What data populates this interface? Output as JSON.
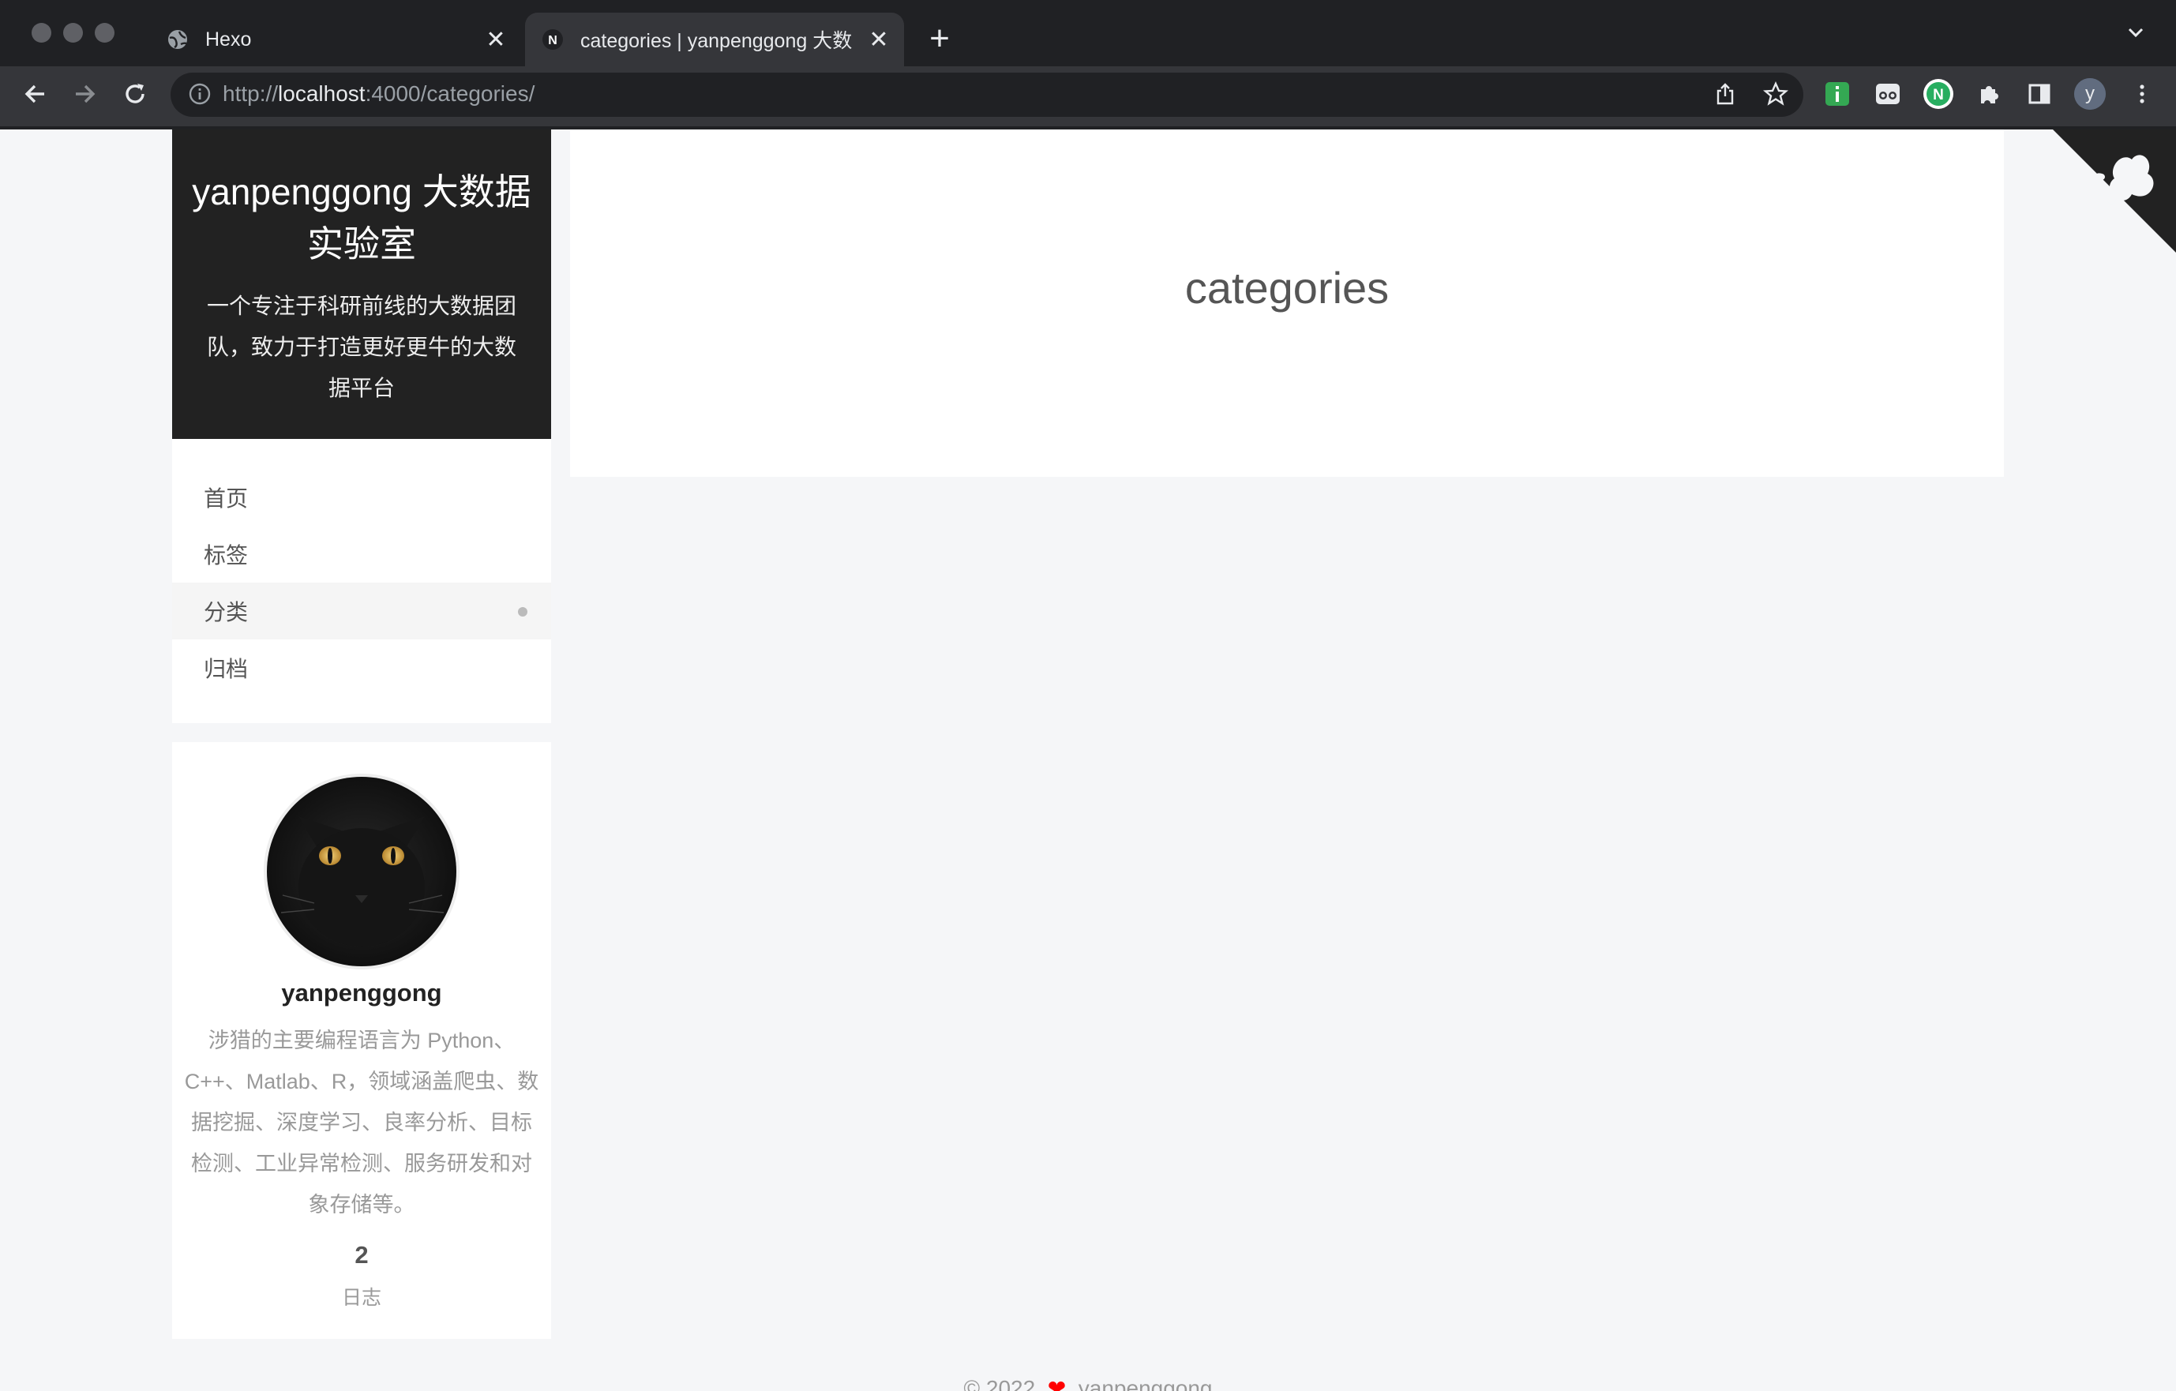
{
  "browser": {
    "tabs": [
      {
        "title": "Hexo",
        "active": false,
        "icon": "globe-icon"
      },
      {
        "title": "categories | yanpenggong 大数",
        "active": true,
        "icon": "n-favicon-icon"
      }
    ],
    "url": {
      "scheme": "http://",
      "host": "localhost",
      "rest": ":4000/categories/"
    },
    "profile_initial": "y"
  },
  "site": {
    "title": "yanpenggong 大数据实验室",
    "subtitle": "一个专注于科研前线的大数据团队，致力于打造更好更牛的大数据平台"
  },
  "menu": {
    "items": [
      {
        "label": "首页",
        "active": false
      },
      {
        "label": "标签",
        "active": false
      },
      {
        "label": "分类",
        "active": true
      },
      {
        "label": "归档",
        "active": false
      }
    ]
  },
  "author": {
    "name": "yanpenggong",
    "description": "涉猎的主要编程语言为 Python、C++、Matlab、R，领域涵盖爬虫、数据挖掘、深度学习、良率分析、目标检测、工业异常检测、服务研发和对象存储等。",
    "posts_count": "2",
    "posts_label": "日志"
  },
  "page": {
    "title": "categories"
  },
  "footer": {
    "copyright": "© 2022",
    "author": "yanpenggong"
  },
  "colors": {
    "brand_bg": "#222222",
    "chrome_dark": "#202124",
    "chrome_toolbar": "#35363a",
    "page_bg": "#f5f6f8"
  }
}
